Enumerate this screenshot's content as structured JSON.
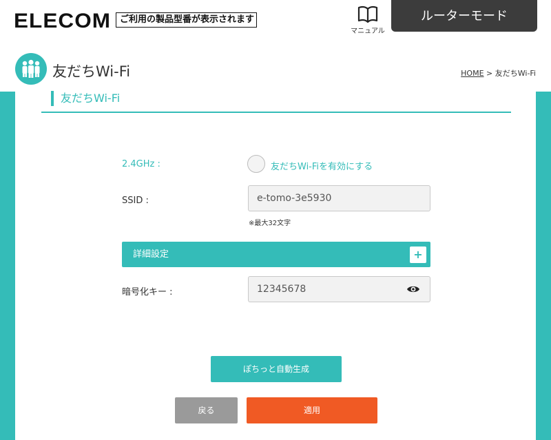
{
  "header": {
    "logo": "ELECOM",
    "model_text": "ご利用の製品型番が表示されます",
    "manual_label": "マニュアル",
    "mode_label": "ルーターモード"
  },
  "page": {
    "title": "友だちWi-Fi",
    "breadcrumb_home": "HOME",
    "breadcrumb_sep": " > ",
    "breadcrumb_current": "友だちWi-Fi"
  },
  "section": {
    "heading": "友だちWi-Fi"
  },
  "form": {
    "band_label": "2.4GHz :",
    "enable_label": "友だちWi-Fiを有効にする",
    "enable_checked": false,
    "ssid_label": "SSID :",
    "ssid_value": "e-tomo-3e5930",
    "ssid_note": "※最大32文字",
    "detail_label": "詳細設定",
    "detail_toggle": "+",
    "key_label": "暗号化キー :",
    "key_value": "12345678"
  },
  "buttons": {
    "auto_generate": "ぽちっと自動生成",
    "back": "戻る",
    "apply": "適用"
  },
  "colors": {
    "accent": "#34bcb8",
    "apply": "#f05a24",
    "back": "#9a9a9a",
    "mode_bg": "#3c3c3c"
  }
}
